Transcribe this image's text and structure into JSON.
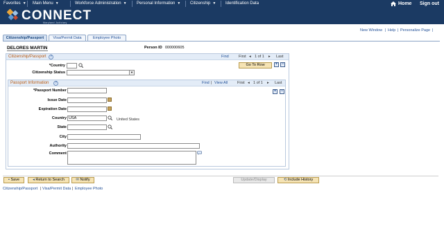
{
  "topnav": {
    "menus": [
      {
        "label": "Favorites"
      },
      {
        "label": "Main Menu"
      },
      {
        "label": "Workforce Administration"
      },
      {
        "label": "Personal Information"
      },
      {
        "label": "Citizenship"
      },
      {
        "label": "Identification Data"
      }
    ],
    "home_label": "Home",
    "signout_label": "Sign out"
  },
  "brand": {
    "name": "CONNECT",
    "subtitle": "Maryland Judiciary"
  },
  "utility": {
    "new_window": "New Window",
    "sep": "|",
    "help": "Help",
    "personalize": "Personalize Page",
    "bar": "|"
  },
  "tabs": [
    "Citizenship/Passport",
    "Visa/Permit Data",
    "Employee Photo"
  ],
  "employee": {
    "name": "DELORES MARTIN",
    "person_id_label": "Person ID",
    "person_id": "000000605"
  },
  "citizenship": {
    "title": "Citizenship/Passport",
    "find": "Find",
    "first": "First",
    "pager": "1 of 1",
    "last": "Last",
    "country_label": "*Country",
    "country_value": "",
    "status_label": "Citizenship Status",
    "status_value": "",
    "go_to_row": "Go To Row"
  },
  "passport": {
    "title": "Passport Information",
    "find": "Find",
    "view_all": "View All",
    "sep": "|",
    "first": "First",
    "pager": "1 of 1",
    "last": "Last",
    "number_label": "*Passport Number",
    "issue_label": "Issue Date",
    "expiration_label": "Expiration Date",
    "country_label": "Country",
    "country_value": "USA",
    "country_desc": "United States",
    "state_label": "State",
    "city_label": "City",
    "authority_label": "Authority",
    "comment_label": "Comment"
  },
  "buttons": {
    "save": "Save",
    "return": "Return to Search",
    "notify": "Notify",
    "update": "Update/Display",
    "history": "Include History"
  },
  "footer_links": {
    "a": "Citizenship/Passport",
    "b": "Visa/Permit Data",
    "c": "Employee Photo",
    "sep": "|"
  },
  "colors": {
    "header_bg": "#1b3a63",
    "link": "#1f4e96",
    "section_title": "#b85a12",
    "button": "#f5e3b4"
  }
}
